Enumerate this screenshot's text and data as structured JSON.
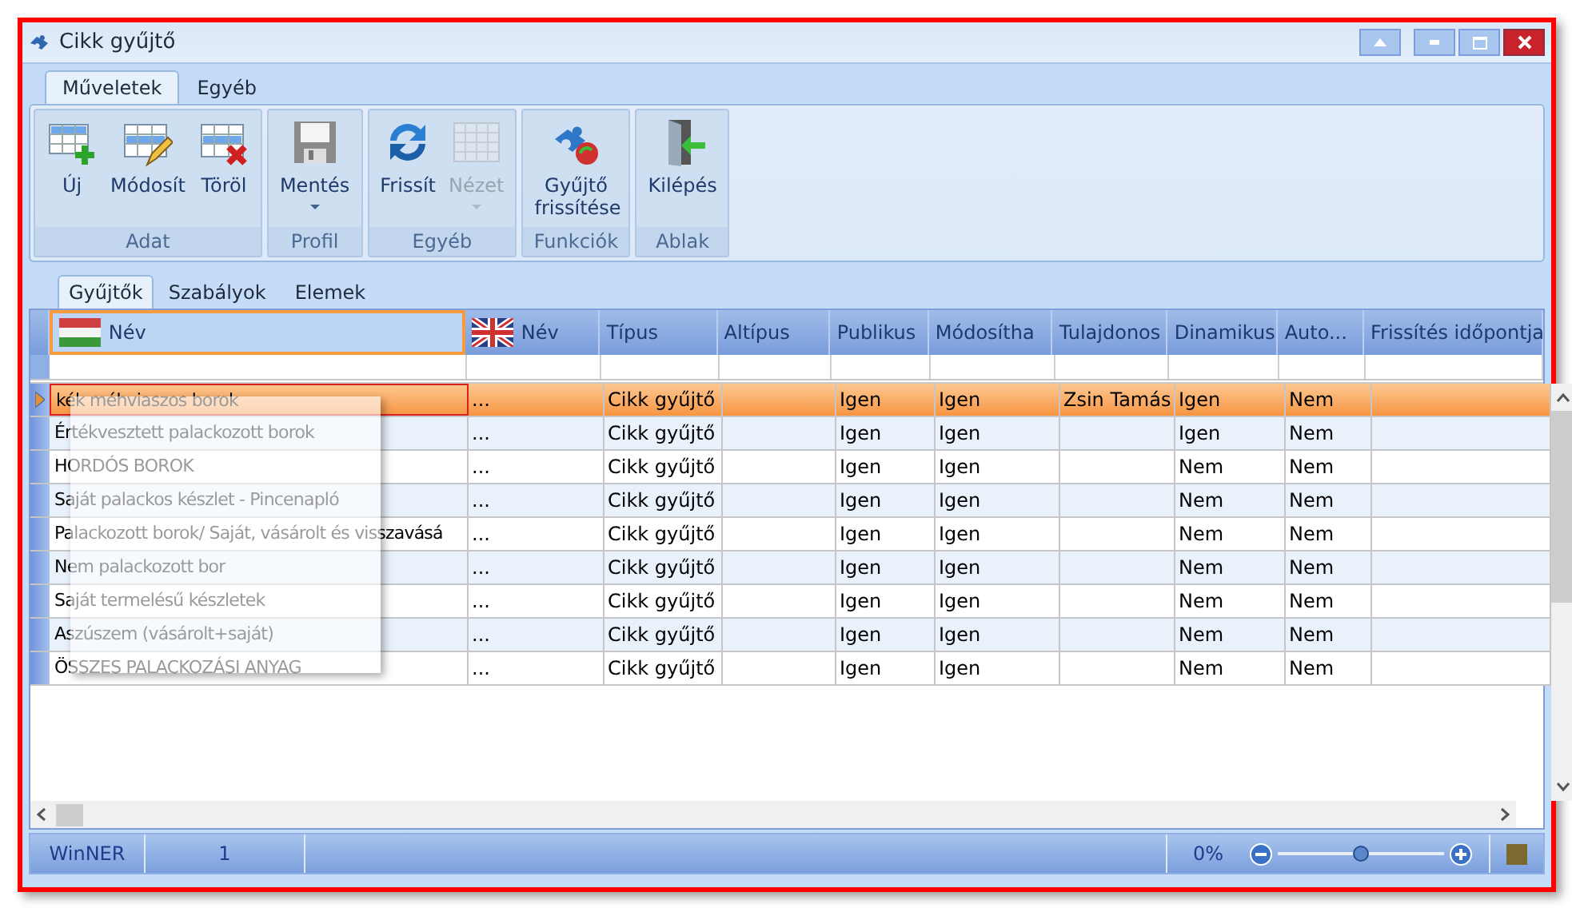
{
  "window": {
    "title": "Cikk gyűjtő"
  },
  "ribbon_tabs": [
    {
      "label": "Műveletek",
      "selected": true
    },
    {
      "label": "Egyéb",
      "selected": false
    }
  ],
  "ribbon_groups": [
    {
      "label": "Adat",
      "buttons": [
        {
          "kind": "add",
          "label": "Új",
          "disabled": false,
          "dropdown": false
        },
        {
          "kind": "edit",
          "label": "Módosít",
          "disabled": false,
          "dropdown": false
        },
        {
          "kind": "delete",
          "label": "Töröl",
          "disabled": false,
          "dropdown": false
        }
      ]
    },
    {
      "label": "Profil",
      "buttons": [
        {
          "kind": "save",
          "label": "Mentés",
          "disabled": false,
          "dropdown": true
        }
      ]
    },
    {
      "label": "Egyéb",
      "buttons": [
        {
          "kind": "refresh",
          "label": "Frissít",
          "disabled": false,
          "dropdown": false
        },
        {
          "kind": "view",
          "label": "Nézet",
          "disabled": true,
          "dropdown": true
        }
      ]
    },
    {
      "label": "Funkciók",
      "buttons": [
        {
          "kind": "puzzle",
          "label": "Gyűjtő frissítése",
          "disabled": false,
          "dropdown": false
        }
      ]
    },
    {
      "label": "Ablak",
      "buttons": [
        {
          "kind": "exit",
          "label": "Kilépés",
          "disabled": false,
          "dropdown": false
        }
      ]
    }
  ],
  "grid_tabs": [
    {
      "label": "Gyűjtők",
      "selected": true
    },
    {
      "label": "Szabályok",
      "selected": false
    },
    {
      "label": "Elemek",
      "selected": false
    }
  ],
  "columns": [
    {
      "label": "Név",
      "kind": "flag_hu",
      "focused": true
    },
    {
      "label": "Név",
      "kind": "flag_en",
      "focused": false
    },
    {
      "label": "Típus",
      "kind": "plain",
      "focused": false
    },
    {
      "label": "Altípus",
      "kind": "plain",
      "focused": false
    },
    {
      "label": "Publikus",
      "kind": "plain",
      "focused": false
    },
    {
      "label": "Módosítha",
      "kind": "plain",
      "focused": false
    },
    {
      "label": "Tulajdonos",
      "kind": "plain",
      "focused": false
    },
    {
      "label": "Dinamikus",
      "kind": "plain",
      "focused": false
    },
    {
      "label": "Auto...",
      "kind": "plain",
      "focused": false
    },
    {
      "label": "Frissítés időpontja",
      "kind": "plain",
      "focused": false
    }
  ],
  "rows": [
    {
      "selected": true,
      "cells": [
        "kék méhviaszos borok",
        "...",
        "Cikk gyűjtő",
        "",
        "Igen",
        "Igen",
        "Zsin Tamás",
        "Igen",
        "Nem",
        ""
      ]
    },
    {
      "selected": false,
      "cells": [
        "Értékvesztett palackozott borok",
        "...",
        "Cikk gyűjtő",
        "",
        "Igen",
        "Igen",
        "",
        "Igen",
        "Nem",
        ""
      ]
    },
    {
      "selected": false,
      "cells": [
        "HORDÓS BOROK",
        "...",
        "Cikk gyűjtő",
        "",
        "Igen",
        "Igen",
        "",
        "Nem",
        "Nem",
        ""
      ]
    },
    {
      "selected": false,
      "cells": [
        "Saját palackos készlet - Pincenapló",
        "...",
        "Cikk gyűjtő",
        "",
        "Igen",
        "Igen",
        "",
        "Nem",
        "Nem",
        ""
      ]
    },
    {
      "selected": false,
      "cells": [
        "Palackozott borok/ Saját, vásárolt és visszavásá",
        "...",
        "Cikk gyűjtő",
        "",
        "Igen",
        "Igen",
        "",
        "Nem",
        "Nem",
        ""
      ]
    },
    {
      "selected": false,
      "cells": [
        "Nem palackozott bor",
        "...",
        "Cikk gyűjtő",
        "",
        "Igen",
        "Igen",
        "",
        "Nem",
        "Nem",
        ""
      ]
    },
    {
      "selected": false,
      "cells": [
        "Saját termelésű készletek",
        "...",
        "Cikk gyűjtő",
        "",
        "Igen",
        "Igen",
        "",
        "Nem",
        "Nem",
        ""
      ]
    },
    {
      "selected": false,
      "cells": [
        "Aszúszem (vásárolt+saját)",
        "...",
        "Cikk gyűjtő",
        "",
        "Igen",
        "Igen",
        "",
        "Nem",
        "Nem",
        ""
      ]
    },
    {
      "selected": false,
      "cells": [
        "ÖSSZES PALACKOZÁSI ANYAG",
        "...",
        "Cikk gyűjtő",
        "",
        "Igen",
        "Igen",
        "",
        "Nem",
        "Nem",
        ""
      ]
    }
  ],
  "status_bar": {
    "app": "WinNER",
    "count": "1",
    "zoom": "0%",
    "zoom_level": {
      "level": 0.5
    }
  }
}
